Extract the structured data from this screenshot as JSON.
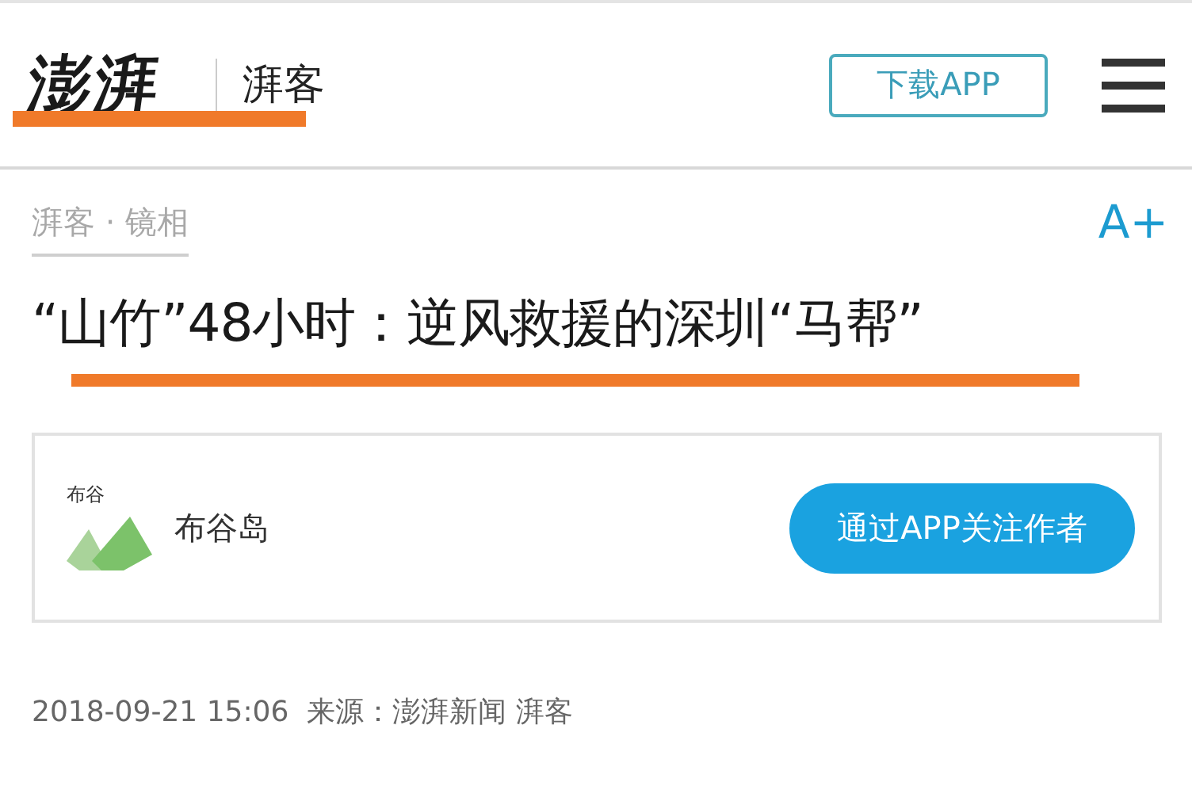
{
  "header": {
    "logo": "澎湃",
    "channel": "湃客",
    "download_button": "下载APP"
  },
  "breadcrumb": "湃客 · 镜相",
  "font_size_button": "A+",
  "headline": "“山竹”48小时：逆风救援的深圳“马帮”",
  "author_card": {
    "avatar_text": "布谷",
    "name": "布谷岛",
    "follow_button": "通过APP关注作者"
  },
  "meta": "2018-09-21 15:06  来源：澎湃新闻 湃客"
}
